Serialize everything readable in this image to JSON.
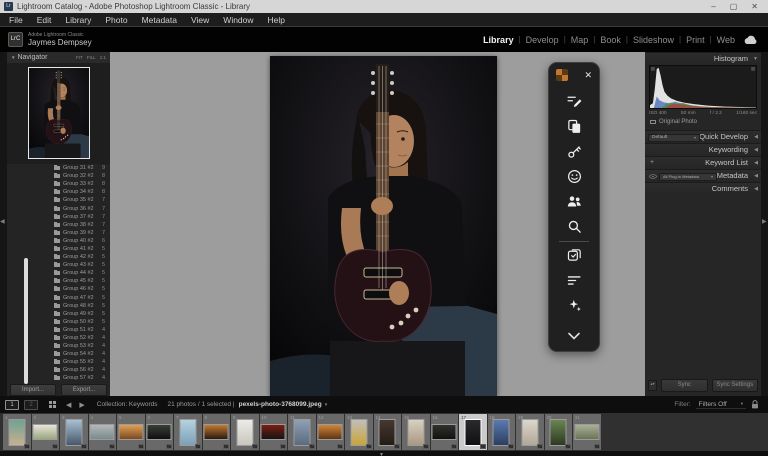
{
  "window": {
    "title": "Lightroom Catalog - Adobe Photoshop Lightroom Classic - Library",
    "app_icon": "Lr",
    "controls": {
      "minimize": "–",
      "maximize": "▢",
      "close": "✕"
    }
  },
  "menu": {
    "items": [
      "File",
      "Edit",
      "Library",
      "Photo",
      "Metadata",
      "View",
      "Window",
      "Help"
    ]
  },
  "identity": {
    "logo": "LrC",
    "app_line": "Adobe Lightroom Classic",
    "name": "Jaymes Dempsey"
  },
  "modules": {
    "items": [
      {
        "label": "Library",
        "active": true
      },
      {
        "label": "Develop",
        "active": false
      },
      {
        "label": "Map",
        "active": false
      },
      {
        "label": "Book",
        "active": false
      },
      {
        "label": "Slideshow",
        "active": false
      },
      {
        "label": "Print",
        "active": false
      },
      {
        "label": "Web",
        "active": false
      }
    ]
  },
  "glyphs": {
    "expand_down": "▼",
    "panel_end": "◀",
    "collapse_left": "◀",
    "collapse_right": "▶",
    "dropdown": "▾",
    "nub": "▼",
    "arrow_back": "◀",
    "arrow_fwd": "▶",
    "toggle": "▴▾"
  },
  "left_panel": {
    "navigator": {
      "title": "Navigator",
      "fit": "FIT",
      "fill": "FILL",
      "ratio": "1:1"
    },
    "folders": {
      "items": [
        {
          "label": "Group 31 #2",
          "count": "9"
        },
        {
          "label": "Group 32 #2",
          "count": "8"
        },
        {
          "label": "Group 33 #2",
          "count": "8"
        },
        {
          "label": "Group 34 #2",
          "count": "8"
        },
        {
          "label": "Group 35 #2",
          "count": "7"
        },
        {
          "label": "Group 36 #2",
          "count": "7"
        },
        {
          "label": "Group 37 #2",
          "count": "7"
        },
        {
          "label": "Group 38 #2",
          "count": "7"
        },
        {
          "label": "Group 39 #2",
          "count": "7"
        },
        {
          "label": "Group 40 #2",
          "count": "6"
        },
        {
          "label": "Group 41 #2",
          "count": "5"
        },
        {
          "label": "Group 42 #2",
          "count": "5"
        },
        {
          "label": "Group 43 #2",
          "count": "5"
        },
        {
          "label": "Group 44 #2",
          "count": "5"
        },
        {
          "label": "Group 45 #2",
          "count": "5"
        },
        {
          "label": "Group 46 #2",
          "count": "5"
        },
        {
          "label": "Group 47 #2",
          "count": "5"
        },
        {
          "label": "Group 48 #2",
          "count": "5"
        },
        {
          "label": "Group 49 #2",
          "count": "5"
        },
        {
          "label": "Group 50 #2",
          "count": "5"
        },
        {
          "label": "Group 51 #2",
          "count": "4"
        },
        {
          "label": "Group 52 #2",
          "count": "4"
        },
        {
          "label": "Group 53 #2",
          "count": "4"
        },
        {
          "label": "Group 54 #2",
          "count": "4"
        },
        {
          "label": "Group 55 #2",
          "count": "4"
        },
        {
          "label": "Group 56 #2",
          "count": "4"
        },
        {
          "label": "Group 57 #2",
          "count": "4"
        }
      ]
    },
    "import_label": "Import...",
    "export_label": "Export..."
  },
  "right_panel": {
    "histogram": {
      "title": "Histogram",
      "iso": "ISO 400",
      "focal": "50 mm",
      "aperture": "f / 2.2",
      "shutter": "1/160 sec",
      "original": "Original Photo"
    },
    "quick_develop": {
      "title": "Quick Develop",
      "preset": "Default"
    },
    "keywording": {
      "title": "Keywording"
    },
    "keyword_list": {
      "title": "Keyword List",
      "plus": "+"
    },
    "metadata": {
      "title": "Metadata",
      "preset": "All Plug-in Metadata"
    },
    "comments": {
      "title": "Comments"
    },
    "sync_label": "Sync",
    "sync_settings_label": "Sync Settings"
  },
  "toolbar_overlay": {
    "icons": [
      "compose-icon",
      "copy-icon",
      "key-icon",
      "emoji-icon",
      "people-icon",
      "search-icon",
      "divider",
      "screenshot-icon",
      "align-lines-icon",
      "sparkle-icon"
    ]
  },
  "filmstrip": {
    "monitor1": "1",
    "monitor2": "2",
    "breadcrumb": "Collection: Keywords",
    "status": "21 photos / 1 selected |",
    "filename": "pexels-photo-3768099.jpeg",
    "filter_label": "Filter:",
    "filter_value": "Filters Off",
    "thumbnails": [
      {
        "n": "1",
        "o": "v",
        "c1": "#6fa293",
        "c2": "#c8b090",
        "sel": false
      },
      {
        "n": "2",
        "o": "h",
        "c1": "#e9e4da",
        "c2": "#9aa77f",
        "sel": false
      },
      {
        "n": "3",
        "o": "v",
        "c1": "#a8c0d4",
        "c2": "#46586a",
        "sel": false
      },
      {
        "n": "4",
        "o": "h",
        "c1": "#b4b8b6",
        "c2": "#7a8a8c",
        "sel": false
      },
      {
        "n": "5",
        "o": "h",
        "c1": "#e0a055",
        "c2": "#7a4a22",
        "sel": false
      },
      {
        "n": "6",
        "o": "h",
        "c1": "#3a3e38",
        "c2": "#0e100e",
        "sel": false
      },
      {
        "n": "7",
        "o": "v",
        "c1": "#b6d2e0",
        "c2": "#7aa0b8",
        "sel": false
      },
      {
        "n": "8",
        "o": "h",
        "c1": "#c27a30",
        "c2": "#2a1a12",
        "sel": false
      },
      {
        "n": "9",
        "o": "v",
        "c1": "#ecebe7",
        "c2": "#c9c6bf",
        "sel": false
      },
      {
        "n": "10",
        "o": "h",
        "c1": "#7a1e10",
        "c2": "#141414",
        "sel": false
      },
      {
        "n": "11",
        "o": "v",
        "c1": "#8fa0b4",
        "c2": "#5a6a80",
        "sel": false
      },
      {
        "n": "12",
        "o": "h",
        "c1": "#d08638",
        "c2": "#5e3415",
        "sel": false
      },
      {
        "n": "13",
        "o": "v",
        "c1": "#c0bfba",
        "c2": "#caa43a",
        "sel": false
      },
      {
        "n": "14",
        "o": "v",
        "c1": "#453830",
        "c2": "#241c16",
        "sel": false
      },
      {
        "n": "15",
        "o": "v",
        "c1": "#d9d0c2",
        "c2": "#a89880",
        "sel": false
      },
      {
        "n": "16",
        "o": "h",
        "c1": "#30302e",
        "c2": "#121210",
        "sel": false
      },
      {
        "n": "17",
        "o": "v",
        "c1": "#2a2a2c",
        "c2": "#101012",
        "sel": true
      },
      {
        "n": "18",
        "o": "v",
        "c1": "#5a7ab0",
        "c2": "#2c3e60",
        "sel": false
      },
      {
        "n": "19",
        "o": "v",
        "c1": "#dcd6cc",
        "c2": "#b0a898",
        "sel": false
      },
      {
        "n": "20",
        "o": "v",
        "c1": "#6a8452",
        "c2": "#2c3a22",
        "sel": false
      },
      {
        "n": "21",
        "o": "h",
        "c1": "#a8b096",
        "c2": "#6a7456",
        "sel": false
      }
    ]
  },
  "colors": {
    "center_bg": "#9d9d9d",
    "panel_bg": "#262626",
    "band_bg": "#020202",
    "titlebar_bg": "#d6d6d6",
    "accent_selected": "#cbcbcb"
  }
}
